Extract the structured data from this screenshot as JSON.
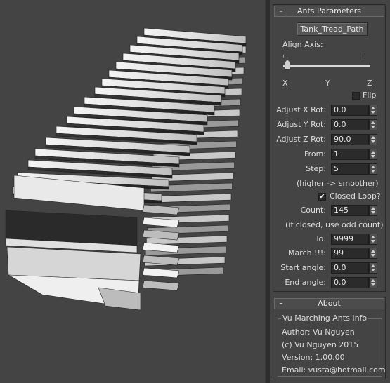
{
  "ants_parameters": {
    "title": "Ants Parameters",
    "collapse_symbol": "–",
    "path_button": "Tank_Tread_Path",
    "align_axis_label": "Align Axis:",
    "axis_labels": [
      "X",
      "Y",
      "Z"
    ],
    "align_axis_value": "X",
    "flip": {
      "label": "Flip",
      "checked": false
    },
    "adjust_x_rot": {
      "label": "Adjust X Rot:",
      "value": "0.0"
    },
    "adjust_y_rot": {
      "label": "Adjust Y Rot:",
      "value": "0.0"
    },
    "adjust_z_rot": {
      "label": "Adjust Z Rot:",
      "value": "90.0"
    },
    "from": {
      "label": "From:",
      "value": "1"
    },
    "step": {
      "label": "Step:",
      "value": "5"
    },
    "step_hint": "(higher -> smoother)",
    "closed_loop": {
      "label": "Closed Loop?",
      "checked": true,
      "mark": "✔"
    },
    "count": {
      "label": "Count:",
      "value": "145"
    },
    "count_hint": "(if closed, use odd count)",
    "to": {
      "label": "To:",
      "value": "9999"
    },
    "march": {
      "label": "March !!!:",
      "value": "99"
    },
    "start_angle": {
      "label": "Start angle:",
      "value": "0.0"
    },
    "end_angle": {
      "label": "End angle:",
      "value": "0.0"
    }
  },
  "about": {
    "title": "About",
    "collapse_symbol": "–",
    "group_title": "Vu Marching Ants Info",
    "author": "Author: Vu Nguyen",
    "copyright": "(c) Vu Nguyen 2015",
    "version": "Version: 1.00.00",
    "email": "Email: vusta@hotmail.com"
  },
  "colors": {
    "viewport_bg": "#444444",
    "panel_bg": "#444444",
    "field_bg": "#2b2b2b",
    "text": "#dcdcdc"
  }
}
